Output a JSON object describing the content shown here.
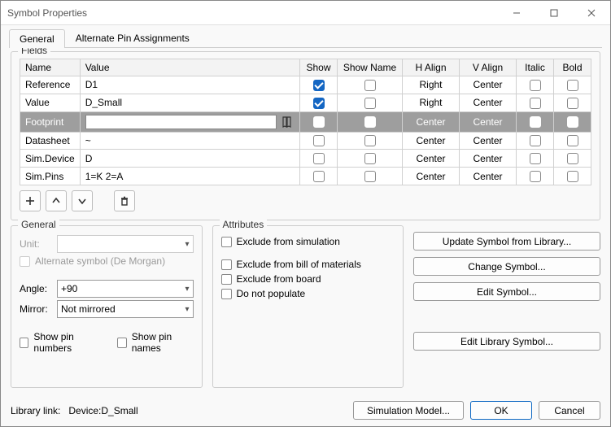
{
  "window": {
    "title": "Symbol Properties"
  },
  "tabs": {
    "general": "General",
    "alternate": "Alternate Pin Assignments"
  },
  "fields_group": {
    "title": "Fields",
    "headers": {
      "name": "Name",
      "value": "Value",
      "show": "Show",
      "show_name": "Show Name",
      "halign": "H Align",
      "valign": "V Align",
      "italic": "Italic",
      "bold": "Bold"
    },
    "rows": [
      {
        "name": "Reference",
        "value": "D1",
        "show": true,
        "show_name": false,
        "halign": "Right",
        "valign": "Center",
        "italic": false,
        "bold": false,
        "selected": false
      },
      {
        "name": "Value",
        "value": "D_Small",
        "show": true,
        "show_name": false,
        "halign": "Right",
        "valign": "Center",
        "italic": false,
        "bold": false,
        "selected": false
      },
      {
        "name": "Footprint",
        "value": "",
        "show": false,
        "show_name": false,
        "halign": "Center",
        "valign": "Center",
        "italic": false,
        "bold": false,
        "selected": true,
        "editor": true
      },
      {
        "name": "Datasheet",
        "value": "~",
        "show": false,
        "show_name": false,
        "halign": "Center",
        "valign": "Center",
        "italic": false,
        "bold": false,
        "selected": false
      },
      {
        "name": "Sim.Device",
        "value": "D",
        "show": false,
        "show_name": false,
        "halign": "Center",
        "valign": "Center",
        "italic": false,
        "bold": false,
        "selected": false
      },
      {
        "name": "Sim.Pins",
        "value": "1=K 2=A",
        "show": false,
        "show_name": false,
        "halign": "Center",
        "valign": "Center",
        "italic": false,
        "bold": false,
        "selected": false
      }
    ]
  },
  "general_group": {
    "title": "General",
    "unit_label": "Unit:",
    "alternate_label": "Alternate symbol (De Morgan)",
    "angle_label": "Angle:",
    "angle_value": "+90",
    "mirror_label": "Mirror:",
    "mirror_value": "Not mirrored",
    "show_pin_numbers": "Show pin numbers",
    "show_pin_names": "Show pin names"
  },
  "attributes_group": {
    "title": "Attributes",
    "exclude_sim": "Exclude from simulation",
    "exclude_bom": "Exclude from bill of materials",
    "exclude_board": "Exclude from board",
    "dnp": "Do not populate"
  },
  "action_buttons": {
    "update": "Update Symbol from Library...",
    "change": "Change Symbol...",
    "edit": "Edit Symbol...",
    "edit_lib": "Edit Library Symbol..."
  },
  "footer": {
    "library_link_label": "Library link:",
    "library_link_value": "Device:D_Small",
    "sim_model": "Simulation Model...",
    "ok": "OK",
    "cancel": "Cancel"
  }
}
